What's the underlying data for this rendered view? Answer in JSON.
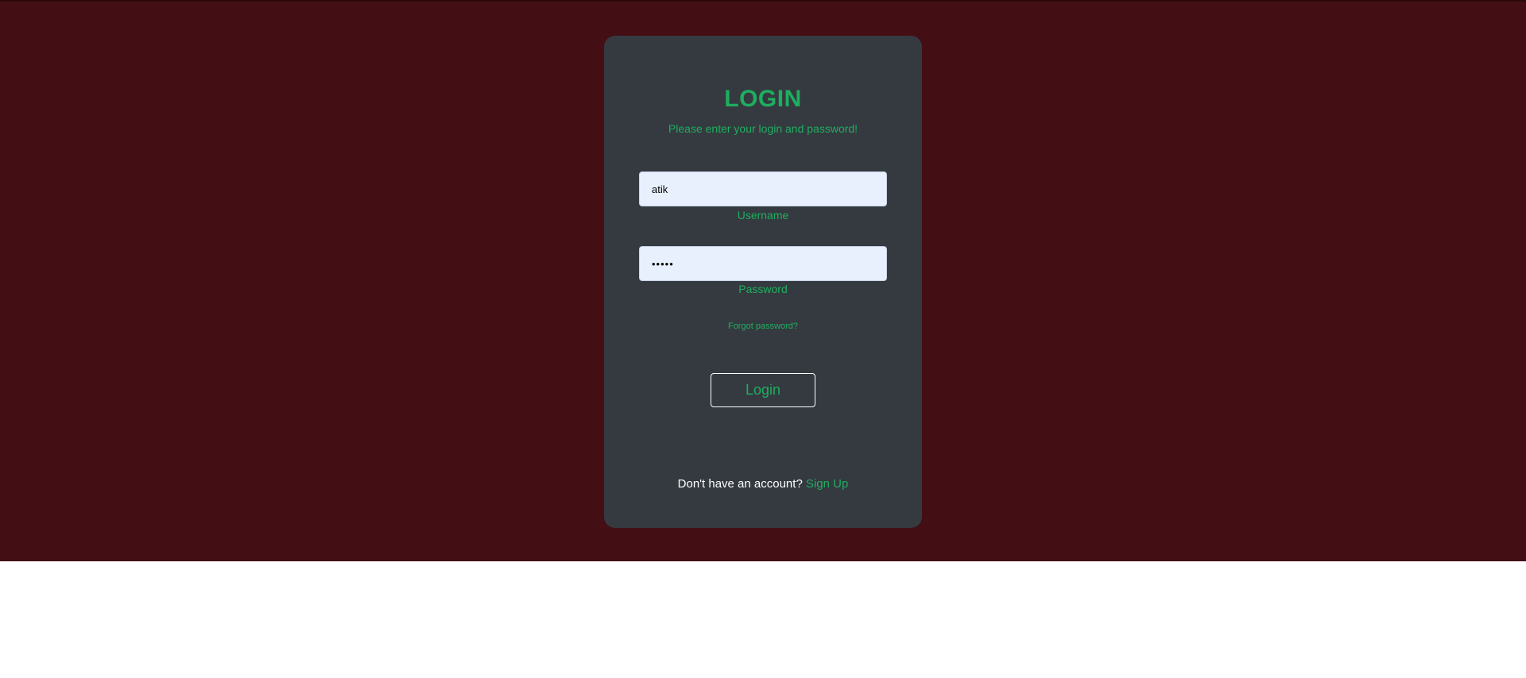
{
  "colors": {
    "page_background": "#430f15",
    "card_background": "#343a40",
    "accent_green": "#1fae5f",
    "input_background": "#e8f0fe",
    "button_border": "#ffffff"
  },
  "login": {
    "title": "LOGIN",
    "subtitle": "Please enter your login and password!",
    "username": {
      "value": "atik",
      "label": "Username"
    },
    "password": {
      "value": "•••••",
      "label": "Password"
    },
    "forgot_password": "Forgot password?",
    "login_button": "Login",
    "signup_prompt": "Don't have an account?",
    "signup_link": "Sign Up"
  }
}
